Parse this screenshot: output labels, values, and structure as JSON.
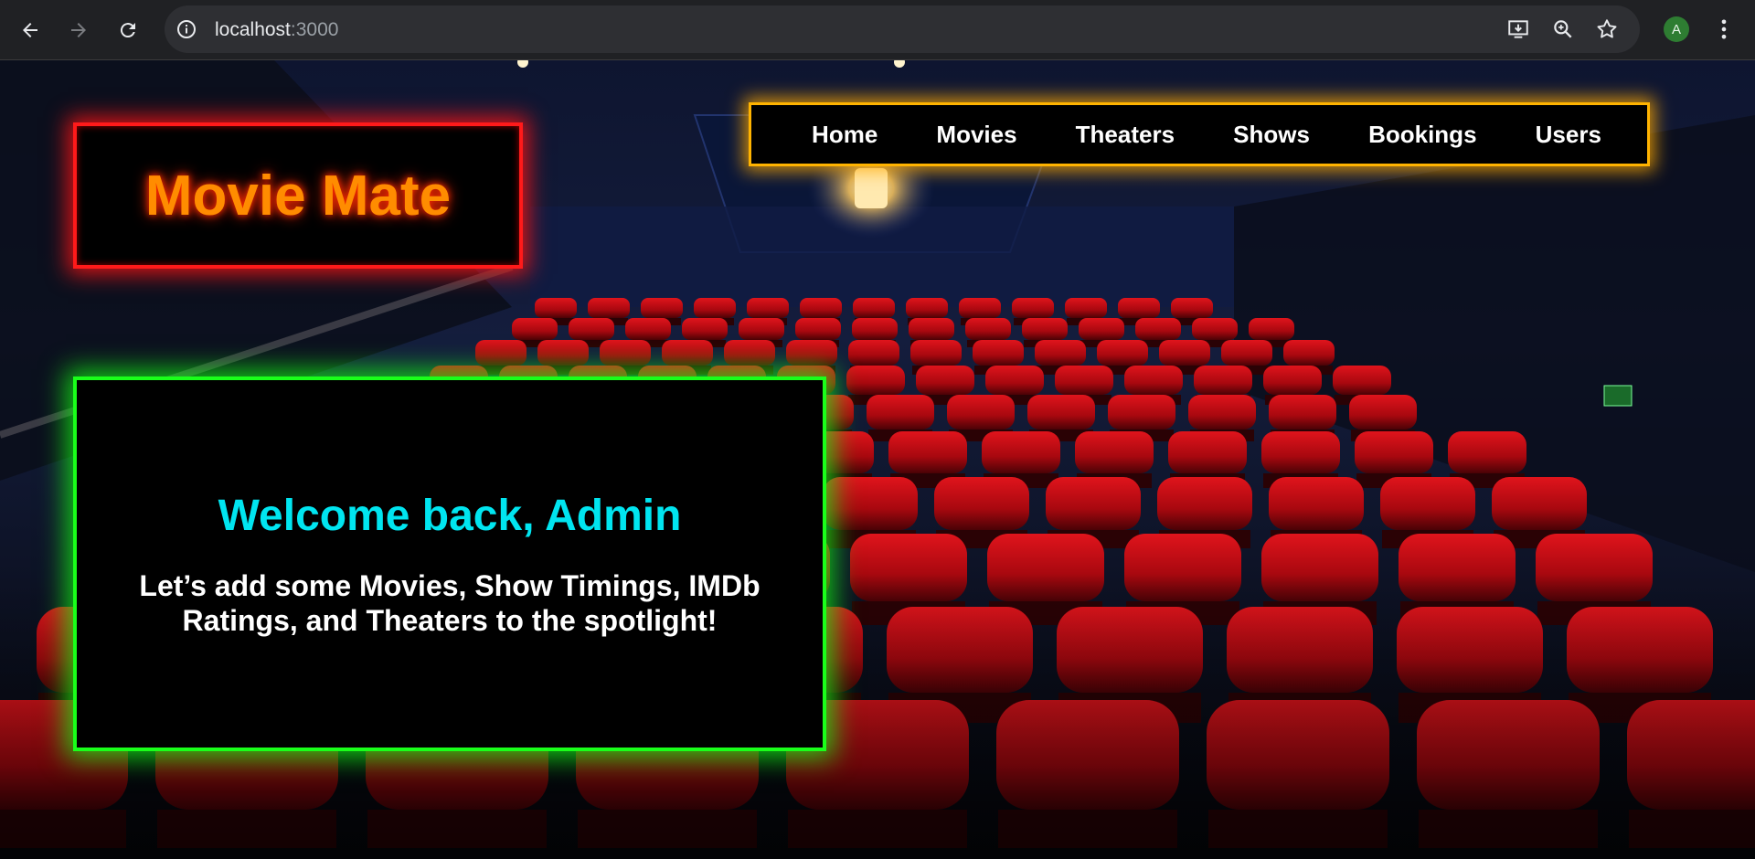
{
  "browser": {
    "url_host": "localhost",
    "url_port": ":3000",
    "avatar_letter": "A",
    "icons": [
      "back-arrow-icon",
      "forward-arrow-icon",
      "reload-icon",
      "site-info-icon",
      "install-app-icon",
      "zoom-icon",
      "bookmark-star-icon",
      "kebab-menu-icon"
    ]
  },
  "brand": {
    "name": "Movie Mate",
    "color": "#ff8c00",
    "border_color": "#ff1a1a"
  },
  "nav": {
    "items": [
      {
        "label": "Home"
      },
      {
        "label": "Movies"
      },
      {
        "label": "Theaters"
      },
      {
        "label": "Shows"
      },
      {
        "label": "Bookings"
      },
      {
        "label": "Users"
      }
    ],
    "border_color": "#ffb300"
  },
  "welcome": {
    "title": "Welcome back, Admin",
    "subtitle": "Let’s add some Movies, Show Timings, IMDb Ratings, and Theaters to the spotlight!",
    "title_color": "#00e5f0",
    "border_color": "#1aff1a"
  }
}
